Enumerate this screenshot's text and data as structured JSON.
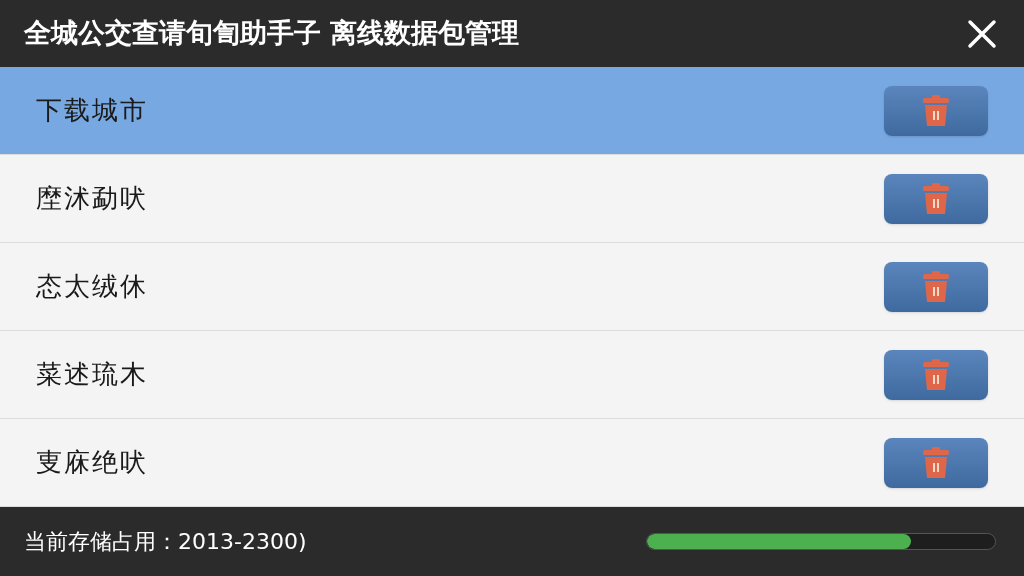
{
  "window": {
    "title": "全城公交查请旬訇助手子 离线数据包管理"
  },
  "cities": [
    {
      "name": "下载城市",
      "selected": true
    },
    {
      "name": "塺沭勐吠",
      "selected": false
    },
    {
      "name": "态太绒休",
      "selected": false
    },
    {
      "name": "菜述琉木",
      "selected": false
    },
    {
      "name": "叓庥绝吠",
      "selected": false
    }
  ],
  "status_bar": {
    "text": "当前存储占用：2013-2300)",
    "storage": {
      "level": 0.76
    }
  }
}
